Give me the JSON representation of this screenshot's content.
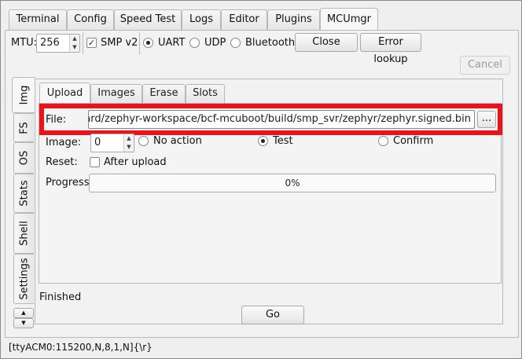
{
  "tabs": [
    "Terminal",
    "Config",
    "Speed Test",
    "Logs",
    "Editor",
    "Plugins",
    "MCUmgr"
  ],
  "active_tab": "MCUmgr",
  "toolbar": {
    "mtu_label": "MTU:",
    "mtu_value": "256",
    "smp_label": "SMP v2",
    "smp_checked": true,
    "transports": [
      "UART",
      "UDP",
      "Bluetooth"
    ],
    "selected_transport": "UART",
    "close_label": "Close",
    "error_lookup_label": "Error lookup",
    "cancel_label": "Cancel"
  },
  "side_tabs": [
    "Img",
    "FS",
    "OS",
    "Stats",
    "Shell",
    "Settings"
  ],
  "active_side_tab": "Img",
  "sub_tabs": [
    "Upload",
    "Images",
    "Erase",
    "Slots"
  ],
  "active_sub_tab": "Upload",
  "upload": {
    "file_label": "File:",
    "file_value": "/BeagleBoard/zephyr-workspace/bcf-mcuboot/build/smp_svr/zephyr/zephyr.signed.bin",
    "browse_label": "...",
    "image_label": "Image:",
    "image_value": "0",
    "actions": [
      "No action",
      "Test",
      "Confirm"
    ],
    "selected_action": "Test",
    "reset_label": "Reset:",
    "after_upload_label": "After upload",
    "after_upload_checked": false,
    "progress_label": "Progress:",
    "progress_text": "0%",
    "progress_value": 0
  },
  "status_text": "Finished",
  "go_label": "Go",
  "statusbar_text": "[ttyACM0:115200,N,8,1,N]{\\r}",
  "colors": {
    "highlight": "#e8141a"
  }
}
